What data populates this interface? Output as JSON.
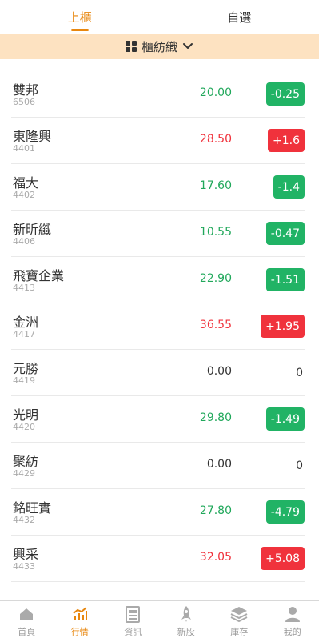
{
  "tabs": [
    {
      "label": "上櫃",
      "active": true
    },
    {
      "label": "自選",
      "active": false
    }
  ],
  "category": {
    "label": "櫃紡織"
  },
  "stocks": [
    {
      "name": "雙邦",
      "code": "6506",
      "price": "20.00",
      "change": "-0.25",
      "direction": "down"
    },
    {
      "name": "東隆興",
      "code": "4401",
      "price": "28.50",
      "change": "+1.6",
      "direction": "up"
    },
    {
      "name": "福大",
      "code": "4402",
      "price": "17.60",
      "change": "-1.4",
      "direction": "down"
    },
    {
      "name": "新昕纖",
      "code": "4406",
      "price": "10.55",
      "change": "-0.47",
      "direction": "down"
    },
    {
      "name": "飛寶企業",
      "code": "4413",
      "price": "22.90",
      "change": "-1.51",
      "direction": "down"
    },
    {
      "name": "金洲",
      "code": "4417",
      "price": "36.55",
      "change": "+1.95",
      "direction": "up"
    },
    {
      "name": "元勝",
      "code": "4419",
      "price": "0.00",
      "change": "0",
      "direction": "flat"
    },
    {
      "name": "光明",
      "code": "4420",
      "price": "29.80",
      "change": "-1.49",
      "direction": "down"
    },
    {
      "name": "聚紡",
      "code": "4429",
      "price": "0.00",
      "change": "0",
      "direction": "flat"
    },
    {
      "name": "銘旺實",
      "code": "4432",
      "price": "27.80",
      "change": "-4.79",
      "direction": "down"
    },
    {
      "name": "興采",
      "code": "4433",
      "price": "32.05",
      "change": "+5.08",
      "direction": "up"
    }
  ],
  "nav": [
    {
      "label": "首頁",
      "icon": "home-icon",
      "active": false
    },
    {
      "label": "行情",
      "icon": "chart-icon",
      "active": true
    },
    {
      "label": "資訊",
      "icon": "news-icon",
      "active": false
    },
    {
      "label": "新股",
      "icon": "rocket-icon",
      "active": false
    },
    {
      "label": "庫存",
      "icon": "layers-icon",
      "active": false
    },
    {
      "label": "我的",
      "icon": "user-icon",
      "active": false
    }
  ],
  "colors": {
    "accent": "#e8870f",
    "up": "#f0323c",
    "down": "#21b365",
    "category_bg": "#fde2c1"
  }
}
